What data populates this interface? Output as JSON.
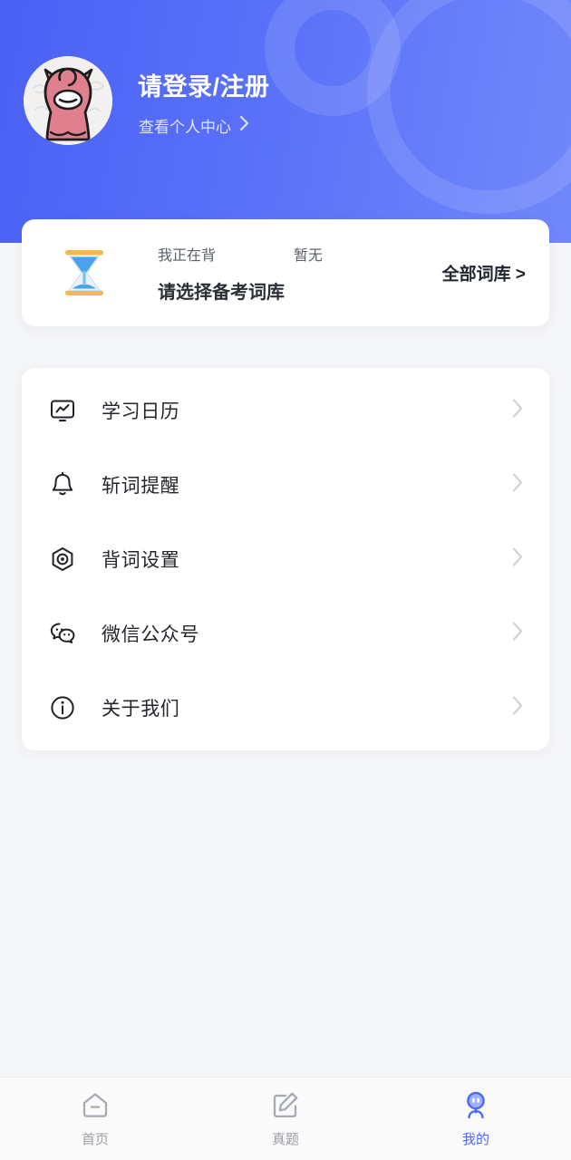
{
  "theme": {
    "header_gradient_from": "#4a61f6",
    "header_gradient_to": "#7188fb",
    "page_bg": "#f5f6f8",
    "card_bg": "#ffffff",
    "accent": "#4f6bf6",
    "text_primary": "#23262c",
    "text_secondary": "#5a5f6b",
    "tab_inactive": "#9a9ea8"
  },
  "header": {
    "title": "请登录/注册",
    "subtitle": "查看个人中心",
    "subtitle_chevron": "chevron-right-icon",
    "avatar": "alpaca-avatar"
  },
  "wordbank": {
    "icon": "hourglass-icon",
    "label": "我正在背",
    "value": "暂无",
    "main_text": "请选择备考词库",
    "all_link": "全部词库 >"
  },
  "menu": {
    "items": [
      {
        "label": "学习日历",
        "icon": "chart-monitor-icon",
        "chevron": "chevron-right-icon"
      },
      {
        "label": "斩词提醒",
        "icon": "bell-icon",
        "chevron": "chevron-right-icon"
      },
      {
        "label": "背词设置",
        "icon": "hex-nut-icon",
        "chevron": "chevron-right-icon"
      },
      {
        "label": "微信公众号",
        "icon": "wechat-icon",
        "chevron": "chevron-right-icon"
      },
      {
        "label": "关于我们",
        "icon": "info-circle-icon",
        "chevron": "chevron-right-icon"
      }
    ]
  },
  "tabbar": {
    "tabs": [
      {
        "label": "首页",
        "icon": "home-icon",
        "active": false
      },
      {
        "label": "真题",
        "icon": "edit-paper-icon",
        "active": false
      },
      {
        "label": "我的",
        "icon": "person-avatar-icon",
        "active": true
      }
    ]
  }
}
